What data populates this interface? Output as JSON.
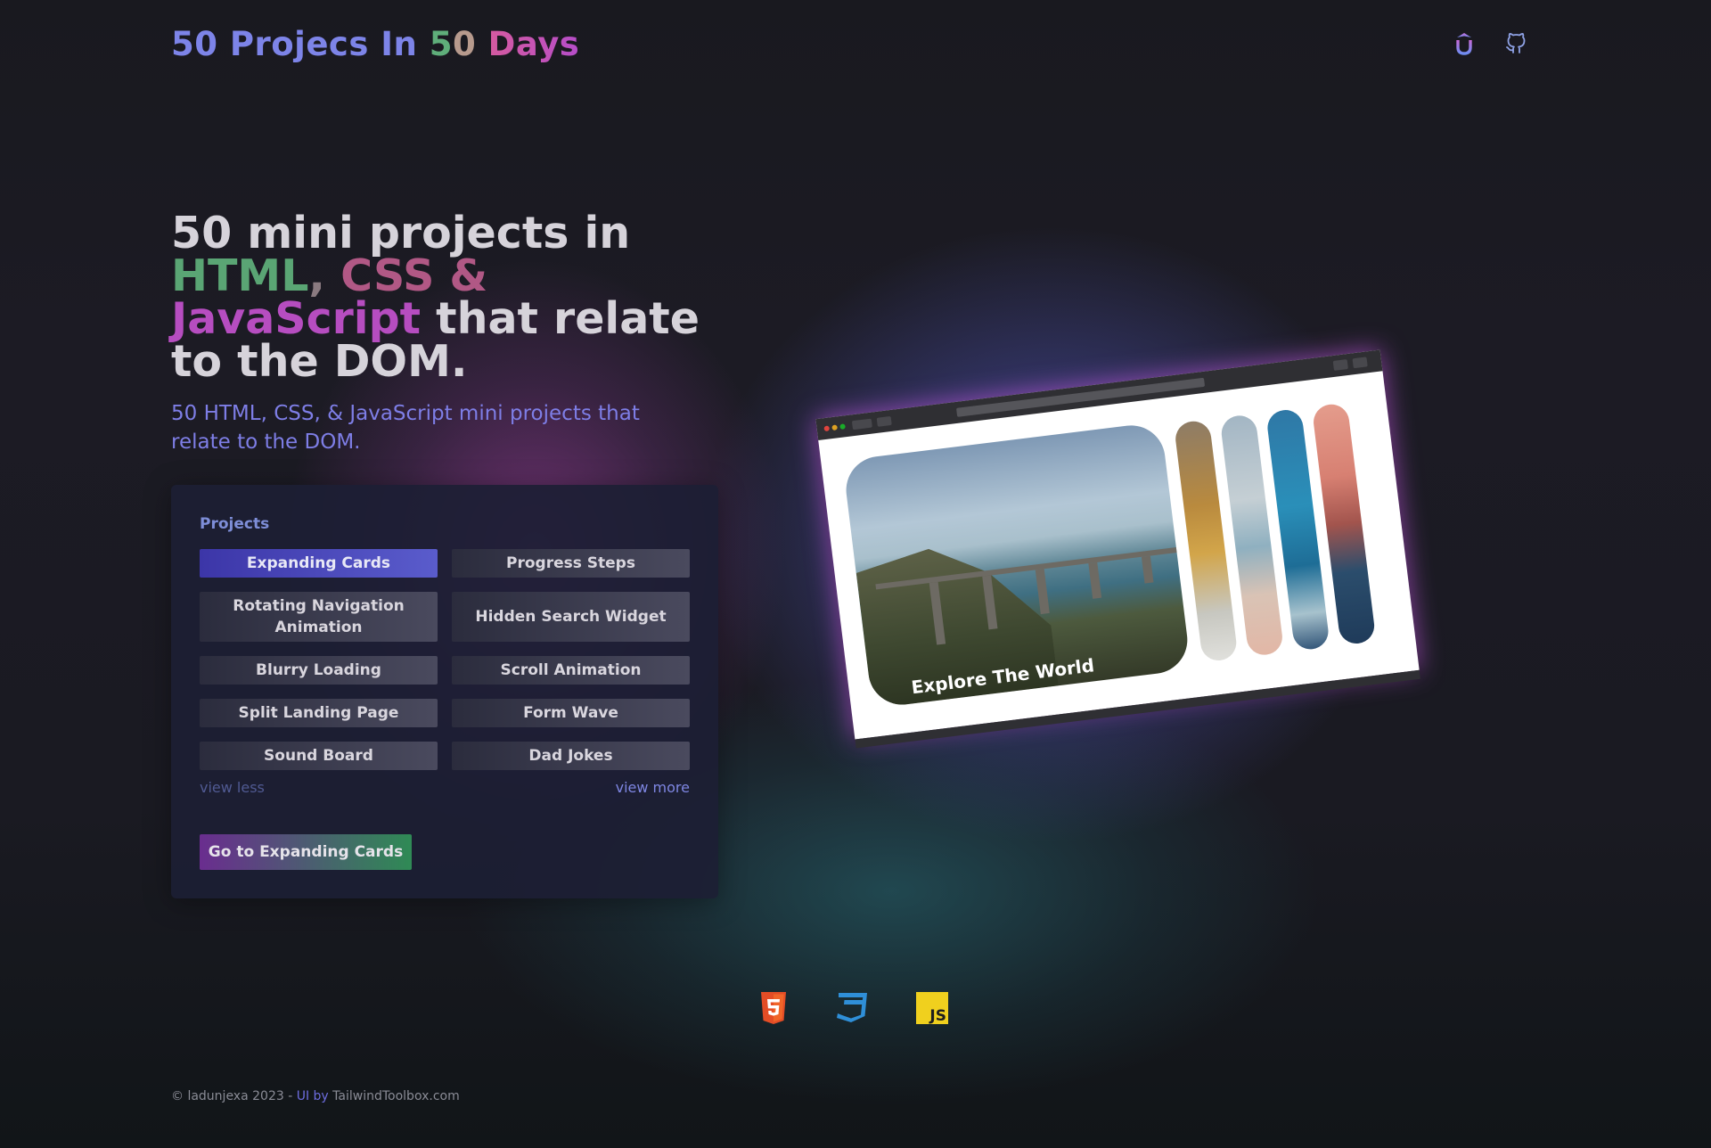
{
  "header": {
    "logo_part1": "50 Projecs In ",
    "logo_five": "5",
    "logo_zero": "0",
    "logo_days": " Days",
    "icons": [
      "udemy-icon",
      "github-icon"
    ]
  },
  "hero": {
    "title_line1": "50 mini projects in",
    "title_html": "HTML",
    "title_comma": ",",
    "title_css": " CSS &",
    "title_js": "JavaScript",
    "title_rest": " that relate to the DOM.",
    "subtitle": "50 HTML, CSS, & JavaScript mini projects that relate to the DOM."
  },
  "projects": {
    "heading": "Projects",
    "items": [
      {
        "label": "Expanding Cards",
        "active": true
      },
      {
        "label": "Progress Steps",
        "active": false
      },
      {
        "label": "Rotating Navigation Animation",
        "active": false
      },
      {
        "label": "Hidden Search Widget",
        "active": false
      },
      {
        "label": "Blurry Loading",
        "active": false
      },
      {
        "label": "Scroll Animation",
        "active": false
      },
      {
        "label": "Split Landing Page",
        "active": false
      },
      {
        "label": "Form Wave",
        "active": false
      },
      {
        "label": "Sound Board",
        "active": false
      },
      {
        "label": "Dad Jokes",
        "active": false
      }
    ],
    "view_less": "view less",
    "view_more": "view more",
    "go_button": "Go to Expanding Cards"
  },
  "preview": {
    "card_title": "Explore The World"
  },
  "tech_icons": [
    "html5-icon",
    "css3-icon",
    "javascript-icon"
  ],
  "footer": {
    "copyright": "© ladunjexa 2023 - ",
    "ui_by": "UI by ",
    "toolbox": "TailwindToolbox.com"
  },
  "colors": {
    "accent": "#7e7ee6",
    "active_button": "#4a48c0",
    "go_button_start": "#6a2d8f",
    "go_button_end": "#2f8a55"
  }
}
